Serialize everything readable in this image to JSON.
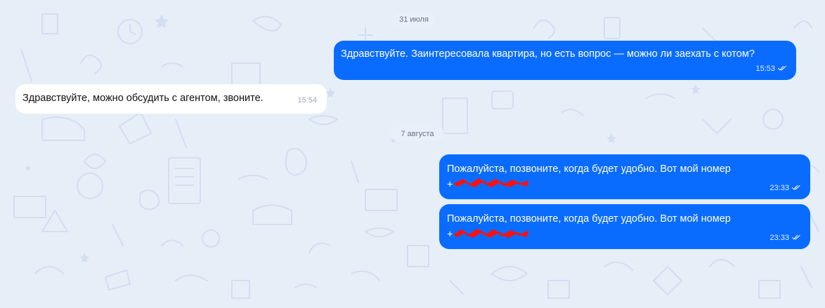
{
  "chat": {
    "colors": {
      "background": "#e6eef8",
      "pattern": "#d3def0",
      "outgoing_bubble": "#0a6cff",
      "incoming_bubble": "#ffffff",
      "redaction": "#ff1010"
    },
    "dates": [
      {
        "label": "31 июля"
      },
      {
        "label": "7 августа"
      }
    ],
    "messages": [
      {
        "direction": "outgoing",
        "text": "Здравствуйте. Заинтересовала квартира, но есть вопрос — можно ли заехать с котом?",
        "time": "15:53",
        "status": "read"
      },
      {
        "direction": "incoming",
        "text": "Здравствуйте, можно обсудить с агентом, звоните.",
        "time": "15:54"
      },
      {
        "direction": "outgoing",
        "text": "Пожалуйста, позвоните, когда будет удобно. Вот мой номер",
        "phone_prefix": "+",
        "phone_redacted": true,
        "time": "23:33",
        "status": "read"
      },
      {
        "direction": "outgoing",
        "text": "Пожалуйста, позвоните, когда будет удобно. Вот мой номер",
        "phone_prefix": "+",
        "phone_redacted": true,
        "time": "23:33",
        "status": "read"
      }
    ]
  }
}
